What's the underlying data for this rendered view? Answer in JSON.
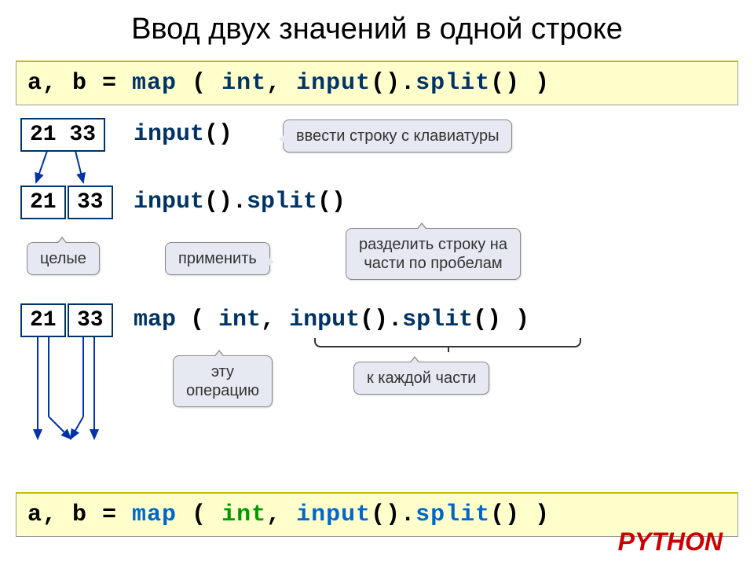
{
  "title": "Ввод двух значений в одной строке",
  "code_top": {
    "a_b": "a, b",
    "eq": " = ",
    "map": "map",
    "open": " ( ",
    "int": "int",
    "comma": ", ",
    "input": "input",
    "parens": "().",
    "split": "split",
    "close": "() )"
  },
  "row1": {
    "box": "21 33",
    "code_input": "input",
    "code_parens": "()",
    "callout": "ввести строку с клавиатуры"
  },
  "row2": {
    "box1": "21",
    "box2": "33",
    "code_input": "input",
    "code_p1": "().",
    "code_split": "split",
    "code_p2": "()",
    "callout_split": "разделить строку на\nчасти по пробелам",
    "callout_int": "целые",
    "callout_apply": "применить"
  },
  "row3": {
    "box1": "21",
    "box2": "33",
    "map": "map",
    "open": " ( ",
    "int": "int",
    "comma": ", ",
    "input": "input",
    "p1": "().",
    "split": "split",
    "close": "() )",
    "callout_op": "эту\nоперацию",
    "callout_each": "к каждой части"
  },
  "code_bottom": {
    "a_b": "a, b",
    "eq": " = ",
    "map": "map",
    "open": " ( ",
    "int": "int",
    "comma": ", ",
    "input": "input",
    "parens": "().",
    "split": "split",
    "close": "() )"
  },
  "python_label": "PYTHON"
}
